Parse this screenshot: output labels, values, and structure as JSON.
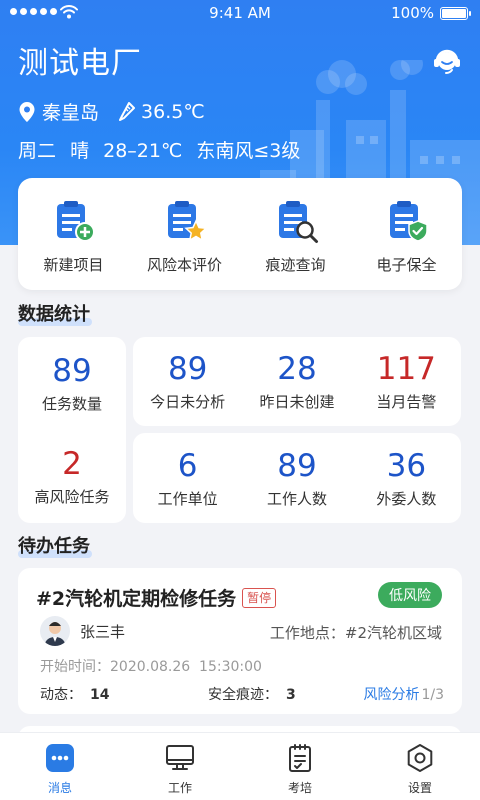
{
  "status_bar": {
    "time": "9:41 AM",
    "battery": "100%"
  },
  "header": {
    "plant_name": "测试电厂",
    "location": "秦皇岛",
    "temperature": "36.5℃",
    "weather": {
      "day": "周二",
      "condition": "晴",
      "range": "28–21℃",
      "wind": "东南风≤3级"
    },
    "service_icon": "customer-service-icon"
  },
  "quick_actions": [
    {
      "label": "新建项目",
      "icon": "clipboard-plus-icon"
    },
    {
      "label": "风险本评价",
      "icon": "clipboard-star-icon"
    },
    {
      "label": "痕迹查询",
      "icon": "clipboard-search-icon"
    },
    {
      "label": "电子保全",
      "icon": "clipboard-shield-icon"
    }
  ],
  "stats_section": {
    "title": "数据统计",
    "left": [
      {
        "value": "89",
        "label": "任务数量",
        "color": "#1d54c8"
      },
      {
        "value": "2",
        "label": "高风险任务",
        "color": "#c62828"
      }
    ],
    "top": [
      {
        "value": "89",
        "label": "今日未分析",
        "color": "#1d54c8"
      },
      {
        "value": "28",
        "label": "昨日未创建",
        "color": "#1d54c8"
      },
      {
        "value": "117",
        "label": "当月告警",
        "color": "#c62828"
      }
    ],
    "bottom": [
      {
        "value": "6",
        "label": "工作单位",
        "color": "#1d54c8"
      },
      {
        "value": "89",
        "label": "工作人数",
        "color": "#1d54c8"
      },
      {
        "value": "36",
        "label": "外委人数",
        "color": "#1d54c8"
      }
    ]
  },
  "todo_section": {
    "title": "待办任务",
    "task": {
      "title": "#2汽轮机定期检修任务",
      "status_tag": "暂停",
      "risk": "低风险",
      "person": "张三丰",
      "location_label": "工作地点：",
      "location": "#2汽轮机区域",
      "start_label": "开始时间：",
      "start_time": "2020.08.26  15:30:00",
      "dynamic_label": "动态：",
      "dynamic_count": "14",
      "trace_label": "安全痕迹：",
      "trace_count": "3",
      "risk_link": "风险分析",
      "page": "1/3"
    }
  },
  "tabbar": [
    {
      "label": "消息",
      "icon": "message-icon",
      "active": true
    },
    {
      "label": "工作",
      "icon": "monitor-icon",
      "active": false
    },
    {
      "label": "考培",
      "icon": "checklist-icon",
      "active": false
    },
    {
      "label": "设置",
      "icon": "hexagon-settings-icon",
      "active": false
    }
  ],
  "colors": {
    "brand_blue": "#2a7be4",
    "header_blue": "#2f7ff2",
    "risk_green": "#3cab5d",
    "alert_red": "#c62828"
  }
}
